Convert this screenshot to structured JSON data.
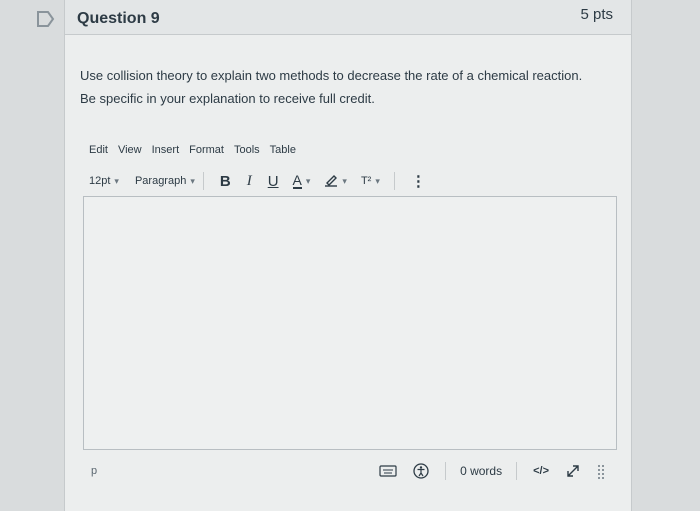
{
  "question": {
    "title": "Question 9",
    "points": "5 pts",
    "prompt": "Use collision theory to explain two methods to decrease the rate of a chemical reaction. Be specific in your explanation to receive full credit."
  },
  "menu": {
    "items": [
      "Edit",
      "View",
      "Insert",
      "Format",
      "Tools",
      "Table"
    ]
  },
  "toolbar": {
    "font_size": "12pt",
    "block_format": "Paragraph",
    "bold": "B",
    "italic": "I",
    "underline": "U",
    "text_color": "A",
    "superscript": "T²",
    "more": "⋮"
  },
  "status": {
    "path": "p",
    "word_count": "0 words",
    "html_toggle": "</>"
  },
  "icons": {
    "flag": "flag-icon",
    "keyboard": "keyboard-icon",
    "accessibility": "accessibility-icon",
    "fullscreen": "expand-icon",
    "resize": "resize-grip-icon"
  }
}
